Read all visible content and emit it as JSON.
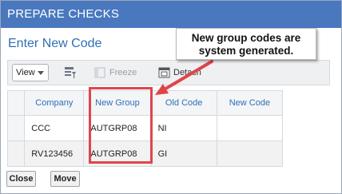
{
  "window": {
    "title": "PREPARE CHECKS"
  },
  "section": {
    "title": "Enter New Code"
  },
  "toolbar": {
    "view_label": "View",
    "freeze_label": "Freeze",
    "detach_label": "Detach"
  },
  "table": {
    "headers": [
      "Company",
      "New Group",
      "Old Code",
      "New Code"
    ],
    "rows": [
      [
        "CCC",
        "AUTGRP08",
        "NI",
        ""
      ],
      [
        "RV123456",
        "AUTGRP08",
        "GI",
        ""
      ]
    ]
  },
  "callout": {
    "line1": "New group codes are",
    "line2": "system generated."
  },
  "buttons": {
    "close": "Close",
    "move": "Move"
  },
  "colors": {
    "titlebar": "#4a78bf",
    "link_blue": "#2f6fb5",
    "highlight_red": "#e0454a"
  }
}
